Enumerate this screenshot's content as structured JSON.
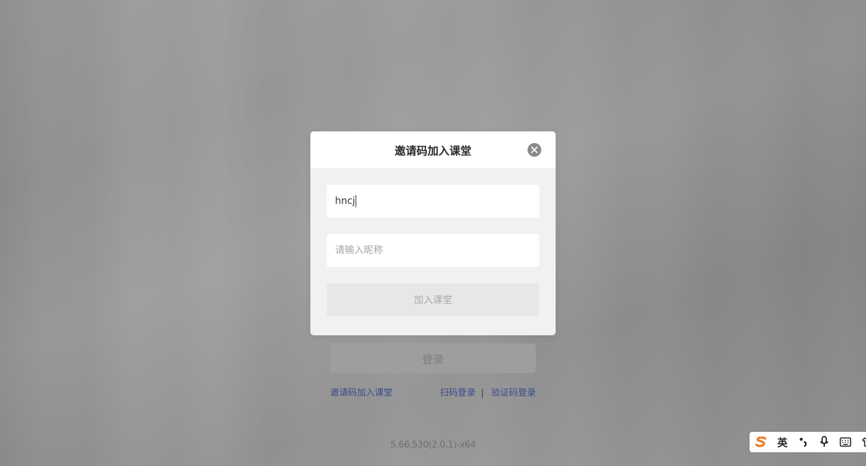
{
  "modal": {
    "title": "邀请码加入课堂",
    "invite_code_value": "hncj",
    "nickname_placeholder": "请输入昵称",
    "join_button_label": "加入课堂"
  },
  "background": {
    "login_button_label": "登录",
    "invite_link_label": "邀请码加入课堂",
    "scan_login_label": "扫码登录",
    "separator": "|",
    "code_login_label": "验证码登录",
    "version": "5.66.530(2.0.1)-x64"
  },
  "ime_toolbar": {
    "language_label": "英",
    "icons": [
      "sogou-logo-icon",
      "punctuation-icon",
      "microphone-icon",
      "keyboard-icon",
      "clothing-skin-icon"
    ]
  },
  "colors": {
    "link_blue": "#3a4a8c",
    "sogou_orange": "#f07a22",
    "close_gray": "#8a8a8a"
  }
}
